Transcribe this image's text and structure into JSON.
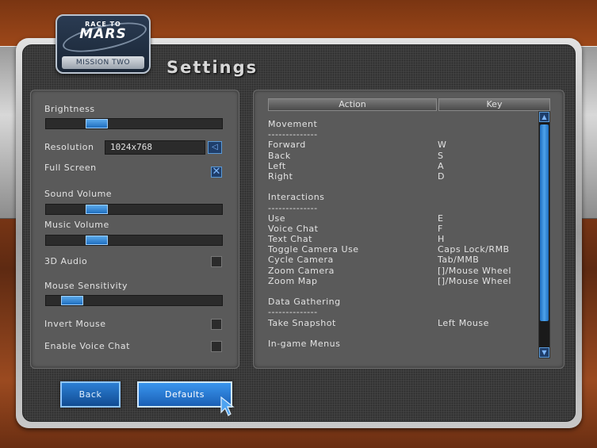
{
  "logo": {
    "race": "RACE TO",
    "mars": "MARS",
    "mission": "MISSION TWO"
  },
  "title": "Settings",
  "settings": {
    "brightness": {
      "label": "Brightness",
      "value": 0.26
    },
    "resolution": {
      "label": "Resolution",
      "value": "1024x768",
      "arrow": "◁"
    },
    "full_screen": {
      "label": "Full Screen",
      "checked": true
    },
    "sound_volume": {
      "label": "Sound Volume",
      "value": 0.26
    },
    "music_volume": {
      "label": "Music Volume",
      "value": 0.26
    },
    "audio_3d": {
      "label": "3D Audio",
      "checked": false
    },
    "mouse_sensitivity": {
      "label": "Mouse Sensitivity",
      "value": 0.1
    },
    "invert_mouse": {
      "label": "Invert Mouse",
      "checked": false
    },
    "voice_chat": {
      "label": "Enable Voice Chat",
      "checked": false
    }
  },
  "keybindings": {
    "col_action": "Action",
    "col_key": "Key",
    "sections": [
      {
        "title": "Movement",
        "divider": "--------------",
        "rows": [
          {
            "action": "Forward",
            "key": "W"
          },
          {
            "action": "Back",
            "key": "S"
          },
          {
            "action": "Left",
            "key": "A"
          },
          {
            "action": "Right",
            "key": "D"
          }
        ]
      },
      {
        "title": "Interactions",
        "divider": "--------------",
        "rows": [
          {
            "action": "Use",
            "key": "E"
          },
          {
            "action": "Voice Chat",
            "key": "F"
          },
          {
            "action": "Text Chat",
            "key": "H"
          },
          {
            "action": "Toggle Camera Use",
            "key": "Caps Lock/RMB"
          },
          {
            "action": "Cycle Camera",
            "key": "Tab/MMB"
          },
          {
            "action": "Zoom Camera",
            "key": "[]/Mouse Wheel"
          },
          {
            "action": "Zoom Map",
            "key": "[]/Mouse Wheel"
          }
        ]
      },
      {
        "title": "Data Gathering",
        "divider": "--------------",
        "rows": [
          {
            "action": "Take Snapshot",
            "key": "Left Mouse"
          }
        ]
      },
      {
        "title": "In-game Menus",
        "divider": "",
        "rows": []
      }
    ]
  },
  "scrollbar": {
    "up": "▲",
    "down": "▼"
  },
  "buttons": {
    "back": "Back",
    "defaults": "Defaults"
  }
}
